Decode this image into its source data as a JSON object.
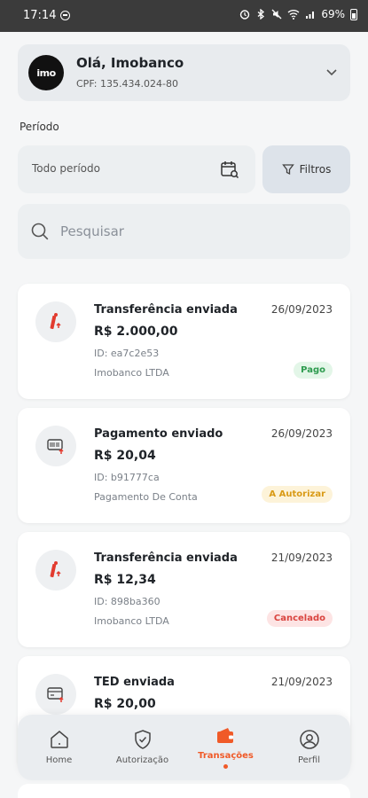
{
  "status_bar": {
    "time": "17:14",
    "battery": "69%"
  },
  "profile": {
    "avatar_text": "imo",
    "greeting": "Olá, Imobanco",
    "cpf": "CPF: 135.434.024-80"
  },
  "filters": {
    "periodo_label": "Período",
    "period_value": "Todo período",
    "filters_label": "Filtros"
  },
  "search": {
    "placeholder": "Pesquisar"
  },
  "transactions": [
    {
      "title": "Transferência enviada",
      "date": "26/09/2023",
      "amount": "R$ 2.000,00",
      "id": "ID: ea7c2e53",
      "party": "Imobanco LTDA",
      "status": "Pago",
      "icon": "imobanco-transfer-icon"
    },
    {
      "title": "Pagamento enviado",
      "date": "26/09/2023",
      "amount": "R$ 20,04",
      "id": "ID: b91777ca",
      "party": "Pagamento De Conta",
      "status": "A Autorizar",
      "icon": "barcode-payment-icon"
    },
    {
      "title": "Transferência enviada",
      "date": "21/09/2023",
      "amount": "R$ 12,34",
      "id": "ID: 898ba360",
      "party": "Imobanco LTDA",
      "status": "Cancelado",
      "icon": "imobanco-transfer-icon"
    },
    {
      "title": "TED enviada",
      "date": "21/09/2023",
      "amount": "R$ 20,00",
      "icon": "card-transfer-icon"
    }
  ],
  "nav": [
    {
      "label": "Home",
      "icon": "home-icon"
    },
    {
      "label": "Autorização",
      "icon": "shield-check-icon"
    },
    {
      "label": "Transações",
      "icon": "wallet-icon",
      "active": true
    },
    {
      "label": "Perfil",
      "icon": "user-icon"
    }
  ],
  "colors": {
    "accent": "#f05a28",
    "pago": "#2e9b4f",
    "autorizar": "#d99a16",
    "cancelado": "#d9433e"
  }
}
